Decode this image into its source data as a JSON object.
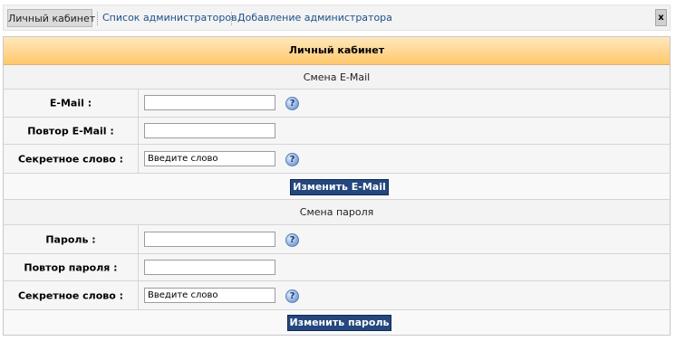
{
  "tabs": {
    "active": "Личный кабинет",
    "admin_list": "Список администраторов",
    "add_admin": "Добавление администратора",
    "close": "x"
  },
  "panel": {
    "title": "Личный кабинет",
    "email_section": {
      "title": "Смена E-Mail",
      "email_label": "E-Mail :",
      "email_value": "",
      "repeat_label": "Повтор E-Mail :",
      "repeat_value": "",
      "secret_label": "Секретное слово :",
      "secret_placeholder": "Введите слово",
      "submit": "Изменить E-Mail"
    },
    "password_section": {
      "title": "Смена пароля",
      "password_label": "Пароль :",
      "password_value": "",
      "repeat_label": "Повтор пароля :",
      "repeat_value": "",
      "secret_label": "Секретное слово :",
      "secret_placeholder": "Введите слово",
      "submit": "Изменить пароль"
    },
    "help_glyph": "?"
  },
  "colors": {
    "header_gradient_top": "#ffe8bd",
    "header_gradient_bottom": "#ffc86b",
    "button_bg": "#24477d",
    "link": "#1c4f86"
  },
  "icons": {
    "help": "question-mark-circle-icon",
    "close": "close-icon"
  }
}
